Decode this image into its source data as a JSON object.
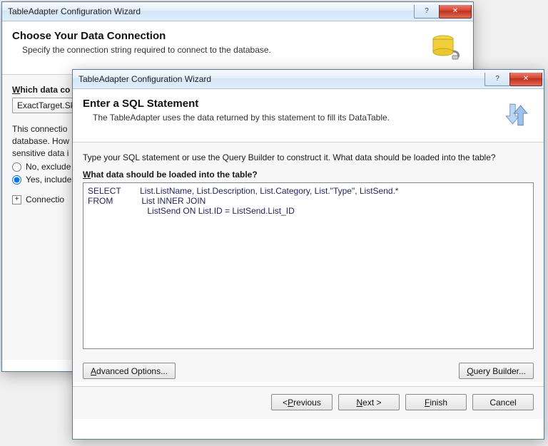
{
  "back": {
    "title": "TableAdapter Configuration Wizard",
    "heading": "Choose Your Data Connection",
    "subheading": "Specify the connection string required to connect to the database.",
    "section_label_pre": "W",
    "section_label_rest": "hich data co",
    "dropdown_value": "ExactTarget.Sk",
    "paragraph": "This connectio\ndatabase. How\nsensitive data i",
    "radio_no": "No, exclude",
    "radio_yes": "Yes, include",
    "expand": "Connectio"
  },
  "front": {
    "title": "TableAdapter Configuration Wizard",
    "heading": "Enter a SQL Statement",
    "subheading": "The TableAdapter uses the data returned by this statement to fill its DataTable.",
    "instruction": "Type your SQL statement or use the Query Builder to construct it. What data should be loaded into the table?",
    "field_label_pre": "W",
    "field_label_rest": "hat data should be loaded into the table?",
    "sql": "SELECT        List.ListName, List.Description, List.Category, List.\"Type\", ListSend.*\nFROM            List INNER JOIN\n                         ListSend ON List.ID = ListSend.List_ID",
    "advanced_pre": "A",
    "advanced_rest": "dvanced Options...",
    "query_builder_pre": "Q",
    "query_builder_rest": "uery Builder...",
    "btn_prev_pre": "< ",
    "btn_prev_u": "P",
    "btn_prev_rest": "revious",
    "btn_next_pre": "",
    "btn_next_u": "N",
    "btn_next_rest": "ext >",
    "btn_finish_pre": "",
    "btn_finish_u": "F",
    "btn_finish_rest": "inish",
    "btn_cancel": "Cancel"
  }
}
